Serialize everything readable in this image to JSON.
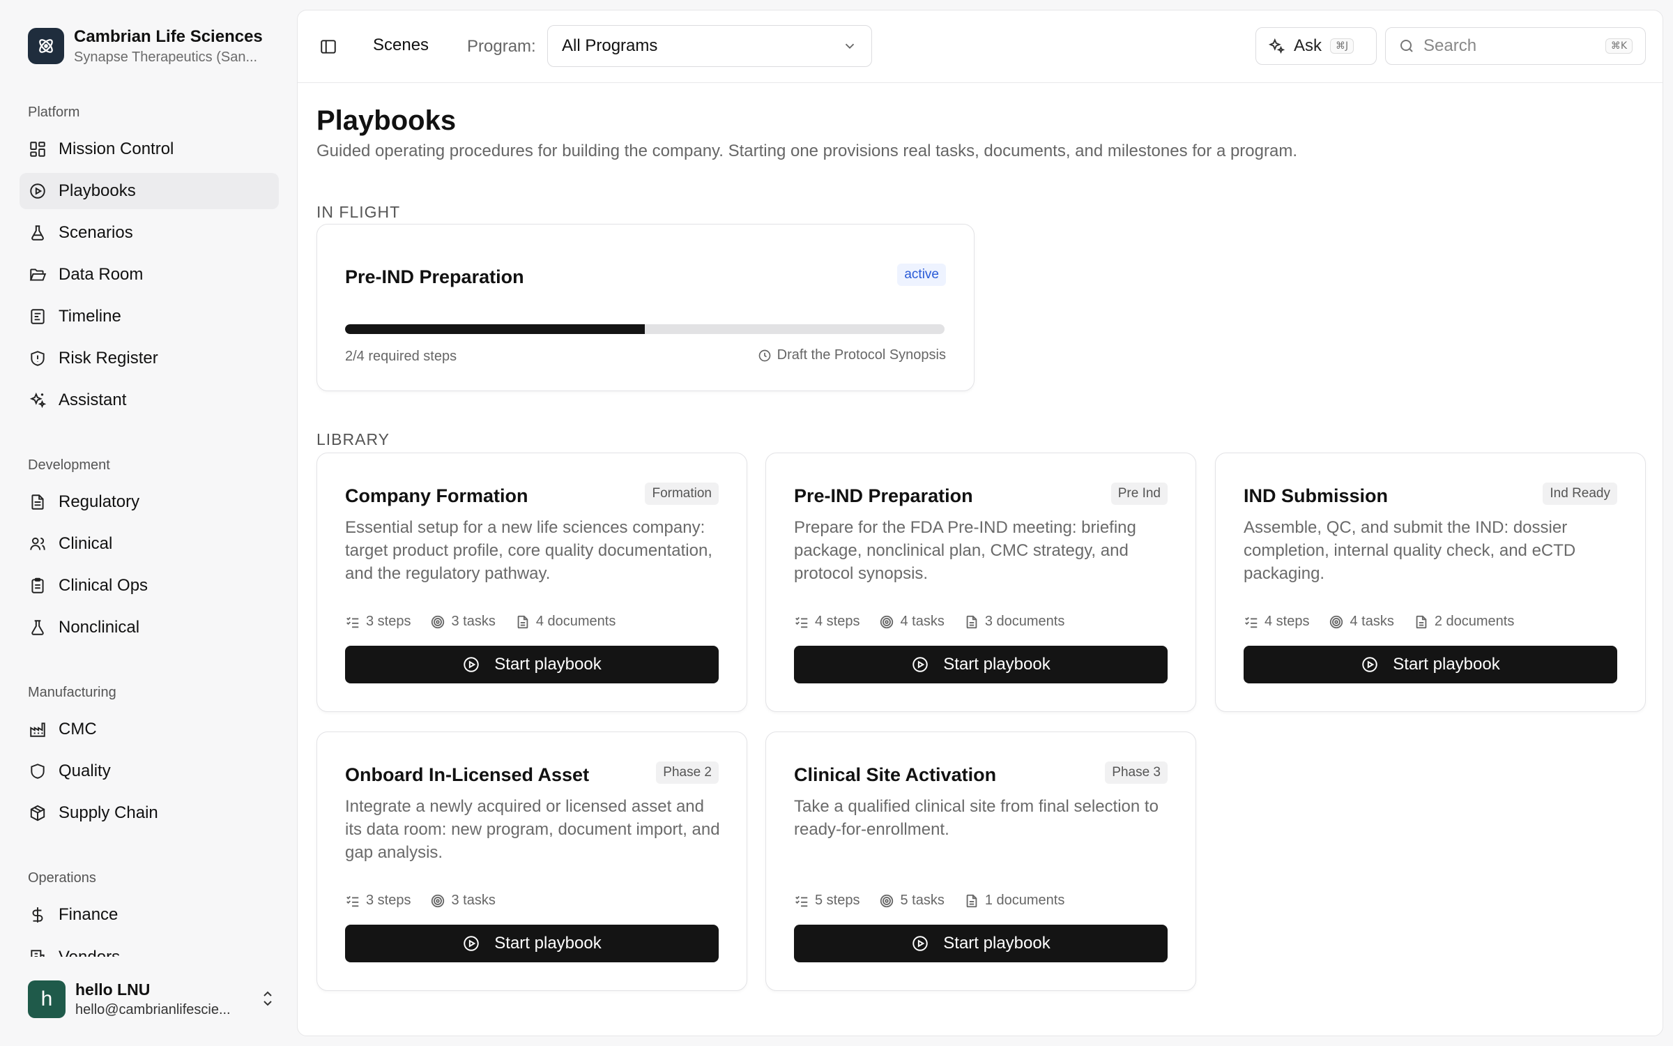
{
  "org": {
    "name": "Cambrian Life Sciences",
    "subtitle": "Synapse Therapeutics (San..."
  },
  "sidebar": {
    "sections": [
      {
        "title": "Platform",
        "items": [
          {
            "label": "Mission Control",
            "icon": "dashboard-icon"
          },
          {
            "label": "Playbooks",
            "icon": "play-circle-icon",
            "active": true
          },
          {
            "label": "Scenarios",
            "icon": "flask-icon"
          },
          {
            "label": "Data Room",
            "icon": "folder-open-icon"
          },
          {
            "label": "Timeline",
            "icon": "timeline-icon"
          },
          {
            "label": "Risk Register",
            "icon": "shield-icon"
          },
          {
            "label": "Assistant",
            "icon": "sparkles-icon"
          }
        ]
      },
      {
        "title": "Development",
        "items": [
          {
            "label": "Regulatory",
            "icon": "file-text-icon"
          },
          {
            "label": "Clinical",
            "icon": "users-icon"
          },
          {
            "label": "Clinical Ops",
            "icon": "clipboard-icon"
          },
          {
            "label": "Nonclinical",
            "icon": "beaker-icon"
          }
        ]
      },
      {
        "title": "Manufacturing",
        "items": [
          {
            "label": "CMC",
            "icon": "factory-icon"
          },
          {
            "label": "Quality",
            "icon": "shield-icon"
          },
          {
            "label": "Supply Chain",
            "icon": "package-icon"
          }
        ]
      },
      {
        "title": "Operations",
        "items": [
          {
            "label": "Finance",
            "icon": "dollar-icon"
          },
          {
            "label": "Vendors",
            "icon": "building-icon"
          }
        ]
      }
    ]
  },
  "user": {
    "initial": "h",
    "name": "hello LNU",
    "email": "hello@cambrianlifescie..."
  },
  "topbar": {
    "scenes_label": "Scenes",
    "program_label": "Program:",
    "program_value": "All Programs",
    "ask_label": "Ask",
    "ask_shortcut": "⌘J",
    "search_placeholder": "Search",
    "search_shortcut": "⌘K"
  },
  "page": {
    "title": "Playbooks",
    "subtitle": "Guided operating procedures for building the company. Starting one provisions real tasks, documents, and milestones for a program.",
    "in_flight_label": "IN FLIGHT",
    "library_label": "LIBRARY"
  },
  "in_flight": {
    "title": "Pre-IND Preparation",
    "status": "active",
    "progress_fraction": 0.5,
    "steps_text": "2/4 required steps",
    "next_step": "Draft the Protocol Synopsis"
  },
  "library": [
    {
      "title": "Company Formation",
      "tag": "Formation",
      "description": "Essential setup for a new life sciences company: target product profile, core quality documentation, and the regulatory pathway.",
      "steps": "3 steps",
      "tasks": "3 tasks",
      "documents": "4 documents",
      "button": "Start playbook"
    },
    {
      "title": "Pre-IND Preparation",
      "tag": "Pre Ind",
      "description": "Prepare for the FDA Pre-IND meeting: briefing package, nonclinical plan, CMC strategy, and protocol synopsis.",
      "steps": "4 steps",
      "tasks": "4 tasks",
      "documents": "3 documents",
      "button": "Start playbook"
    },
    {
      "title": "IND Submission",
      "tag": "Ind Ready",
      "description": "Assemble, QC, and submit the IND: dossier completion, internal quality check, and eCTD packaging.",
      "steps": "4 steps",
      "tasks": "4 tasks",
      "documents": "2 documents",
      "button": "Start playbook"
    },
    {
      "title": "Onboard In-Licensed Asset",
      "tag": "Phase 2",
      "description": "Integrate a newly acquired or licensed asset and its data room: new program, document import, and gap analysis.",
      "steps": "3 steps",
      "tasks": "3 tasks",
      "documents": "",
      "button": "Start playbook"
    },
    {
      "title": "Clinical Site Activation",
      "tag": "Phase 3",
      "description": "Take a qualified clinical site from final selection to ready-for-enrollment.",
      "steps": "5 steps",
      "tasks": "5 tasks",
      "documents": "1 documents",
      "button": "Start playbook"
    }
  ],
  "colors": {
    "accent_dark": "#141414",
    "active_badge": "#2a5bd7",
    "logo_bg": "#1f2d3d",
    "avatar_bg": "#1f5a4a"
  }
}
